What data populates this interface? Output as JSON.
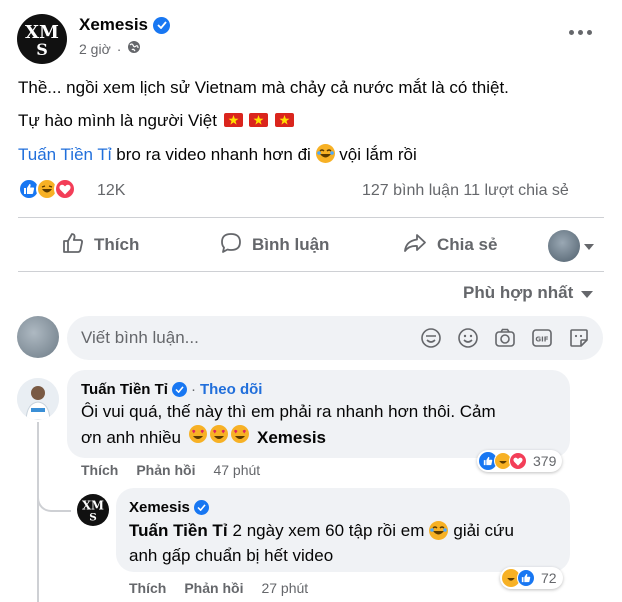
{
  "post": {
    "author": "Xemesis",
    "time": "2 giờ",
    "line1": "Thề... ngồi xem lịch sử Vietnam mà chảy cả nước mắt là có thiệt.",
    "line2": "Tự hào mình là người Việt",
    "line3_mention": "Tuấn Tiền Tỉ",
    "line3_text": "bro ra video nhanh hơn đi",
    "line3_end": "vội lắm rồi"
  },
  "stats": {
    "reaction_count": "12K",
    "comments_shares": "127 bình luận  11 lượt chia sẻ",
    "reactions": [
      "like-icon",
      "haha-icon",
      "love-icon"
    ]
  },
  "actions": {
    "like": "Thích",
    "comment": "Bình luận",
    "share": "Chia sẻ"
  },
  "sort_label": "Phù hợp nhất",
  "composer_placeholder": "Viết bình luận...",
  "comments": [
    {
      "author": "Tuấn Tiền Tỉ",
      "follow": "Theo dõi",
      "text_line1": "Ôi vui quá, thế này thì em phải ra nhanh hơn thôi. Cảm",
      "text_line2": "ơn anh nhiều",
      "mention": "Xemesis",
      "like_label": "Thích",
      "reply_label": "Phản hồi",
      "time": "47 phút",
      "reaction_count": "379"
    },
    {
      "author": "Xemesis",
      "mention": "Tuấn Tiền Tỉ",
      "text_line1": "2 ngày xem 60 tập rồi em",
      "text_line1_end": "giải cứu",
      "text_line2": "anh gấp chuẩn bị hết video",
      "like_label": "Thích",
      "reply_label": "Phản hồi",
      "time": "27 phút",
      "reaction_count": "72"
    }
  ],
  "colors": {
    "brand_blue": "#1877f2",
    "mention_blue": "#216fdb",
    "secondary_text": "#65676b",
    "bubble_bg": "#f0f2f5"
  }
}
